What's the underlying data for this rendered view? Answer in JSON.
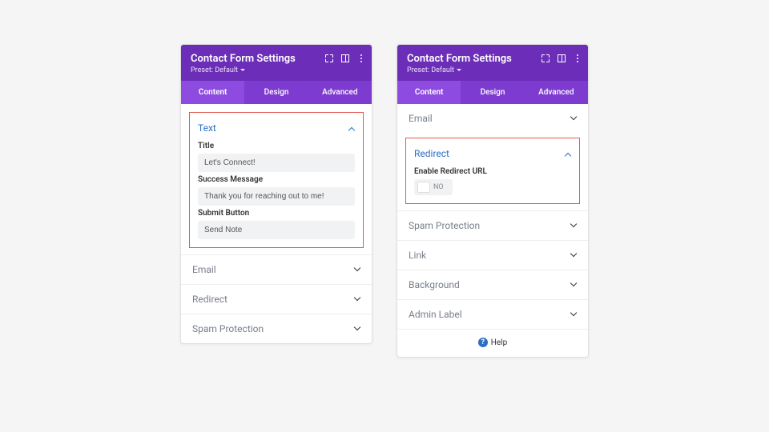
{
  "header": {
    "title": "Contact Form Settings",
    "preset_label": "Preset: Default"
  },
  "tabs": {
    "content": "Content",
    "design": "Design",
    "advanced": "Advanced"
  },
  "panel1": {
    "text_section": {
      "heading": "Text",
      "fields": {
        "title_label": "Title",
        "title_value": "Let's Connect!",
        "success_label": "Success Message",
        "success_value": "Thank you for reaching out to me!",
        "submit_label": "Submit Button",
        "submit_value": "Send Note"
      }
    },
    "collapsed": {
      "email": "Email",
      "redirect": "Redirect",
      "spam": "Spam Protection"
    }
  },
  "panel2": {
    "email": "Email",
    "redirect_section": {
      "heading": "Redirect",
      "enable_label": "Enable Redirect URL",
      "toggle_value": "NO"
    },
    "collapsed": {
      "spam": "Spam Protection",
      "link": "Link",
      "background": "Background",
      "admin": "Admin Label"
    },
    "help": "Help"
  }
}
